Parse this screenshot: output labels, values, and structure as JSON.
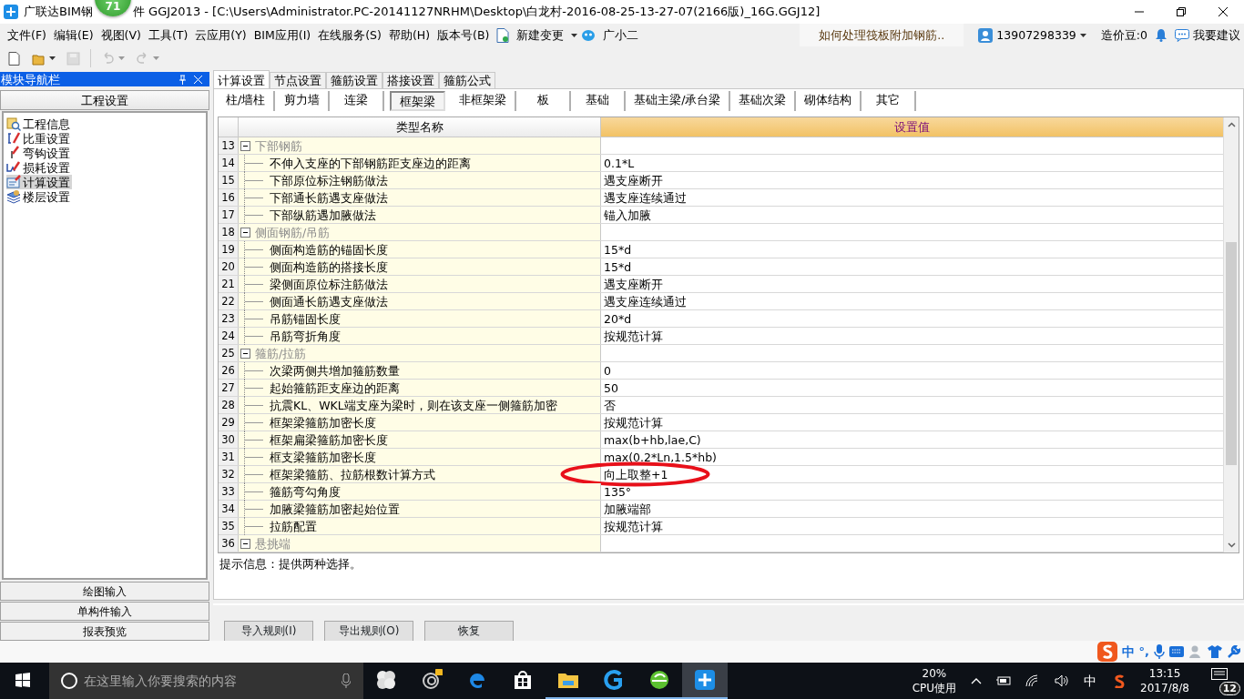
{
  "window": {
    "title_start": "广联达BIM钢",
    "badge": "71",
    "title_end": "件 GGJ2013 - [C:\\Users\\Administrator.PC-20141127NRHM\\Desktop\\白龙村-2016-08-25-13-27-07(2166版)_16G.GGJ12]"
  },
  "menu": [
    "文件(F)",
    "编辑(E)",
    "视图(V)",
    "工具(T)",
    "云应用(Y)",
    "BIM应用(I)",
    "在线服务(S)",
    "帮助(H)",
    "版本号(B)"
  ],
  "menu_extras": [
    {
      "kind": "new-change",
      "label": "新建变更"
    },
    {
      "kind": "assistant",
      "label": "广小二"
    }
  ],
  "news": "如何处理筏板附加钢筋..",
  "account": {
    "phone": "13907298339",
    "beans": "造价豆:0",
    "suggest": "我要建议"
  },
  "toolbar": [
    {
      "kind": "new",
      "disabled": false,
      "dropdown": false
    },
    {
      "kind": "open",
      "disabled": false,
      "dropdown": true
    },
    {
      "kind": "save",
      "disabled": true,
      "dropdown": false
    },
    {
      "kind": "undo",
      "disabled": true,
      "dropdown": true
    },
    {
      "kind": "redo",
      "disabled": true,
      "dropdown": true
    }
  ],
  "nav": {
    "title": "模块导航栏",
    "section": "工程设置",
    "items": [
      {
        "kind": "info",
        "label": "工程信息",
        "selected": false
      },
      {
        "kind": "density",
        "label": "比重设置",
        "selected": false
      },
      {
        "kind": "hook",
        "label": "弯钩设置",
        "selected": false
      },
      {
        "kind": "loss",
        "label": "损耗设置",
        "selected": false
      },
      {
        "kind": "calc",
        "label": "计算设置",
        "selected": true
      },
      {
        "kind": "floor",
        "label": "楼层设置",
        "selected": false
      }
    ],
    "bottom": [
      "绘图输入",
      "单构件输入",
      "报表预览"
    ]
  },
  "tabs": [
    {
      "label": "计算设置",
      "selected": true
    },
    {
      "label": "节点设置",
      "selected": false
    },
    {
      "label": "箍筋设置",
      "selected": false
    },
    {
      "label": "搭接设置",
      "selected": false
    },
    {
      "label": "箍筋公式",
      "selected": false
    }
  ],
  "subtabs": [
    {
      "label": "柱/墙柱",
      "selected": false
    },
    {
      "label": "剪力墙",
      "selected": false
    },
    {
      "label": "连梁",
      "selected": false
    },
    {
      "label": "框架梁",
      "selected": true
    },
    {
      "label": "非框架梁",
      "selected": false
    },
    {
      "label": "板",
      "selected": false
    },
    {
      "label": "基础",
      "selected": false
    },
    {
      "label": "基础主梁/承台梁",
      "selected": false
    },
    {
      "label": "基础次梁",
      "selected": false
    },
    {
      "label": "砌体结构",
      "selected": false
    },
    {
      "label": "其它",
      "selected": false
    }
  ],
  "grid": {
    "columns": [
      "类型名称",
      "设置值"
    ],
    "rows": [
      {
        "num": "13",
        "kind": "group",
        "name": "下部钢筋",
        "expanded": true
      },
      {
        "num": "14",
        "kind": "item",
        "name": "不伸入支座的下部钢筋距支座边的距离",
        "value": "0.1*L",
        "circled": false
      },
      {
        "num": "15",
        "kind": "item",
        "name": "下部原位标注钢筋做法",
        "value": "遇支座断开",
        "circled": false
      },
      {
        "num": "16",
        "kind": "item",
        "name": "下部通长筋遇支座做法",
        "value": "遇支座连续通过",
        "circled": false
      },
      {
        "num": "17",
        "kind": "item",
        "name": "下部纵筋遇加腋做法",
        "value": "锚入加腋",
        "circled": false
      },
      {
        "num": "18",
        "kind": "group",
        "name": "侧面钢筋/吊筋",
        "expanded": true
      },
      {
        "num": "19",
        "kind": "item",
        "name": "侧面构造筋的锚固长度",
        "value": "15*d",
        "circled": false
      },
      {
        "num": "20",
        "kind": "item",
        "name": "侧面构造筋的搭接长度",
        "value": "15*d",
        "circled": false
      },
      {
        "num": "21",
        "kind": "item",
        "name": "梁侧面原位标注筋做法",
        "value": "遇支座断开",
        "circled": false
      },
      {
        "num": "22",
        "kind": "item",
        "name": "侧面通长筋遇支座做法",
        "value": "遇支座连续通过",
        "circled": false
      },
      {
        "num": "23",
        "kind": "item",
        "name": "吊筋锚固长度",
        "value": "20*d",
        "circled": false
      },
      {
        "num": "24",
        "kind": "item",
        "name": "吊筋弯折角度",
        "value": "按规范计算",
        "circled": false
      },
      {
        "num": "25",
        "kind": "group",
        "name": "箍筋/拉筋",
        "expanded": true
      },
      {
        "num": "26",
        "kind": "item",
        "name": "次梁两侧共增加箍筋数量",
        "value": "0",
        "circled": false
      },
      {
        "num": "27",
        "kind": "item",
        "name": "起始箍筋距支座边的距离",
        "value": "50",
        "circled": false
      },
      {
        "num": "28",
        "kind": "item",
        "name": "抗震KL、WKL端支座为梁时，则在该支座一侧箍筋加密",
        "value": "否",
        "circled": false
      },
      {
        "num": "29",
        "kind": "item",
        "name": "框架梁箍筋加密长度",
        "value": "按规范计算",
        "circled": false
      },
      {
        "num": "30",
        "kind": "item",
        "name": "框架扁梁箍筋加密长度",
        "value": "max(b+hb,lae,C)",
        "circled": false
      },
      {
        "num": "31",
        "kind": "item",
        "name": "框支梁箍筋加密长度",
        "value": "max(0.2*Ln,1.5*hb)",
        "circled": false
      },
      {
        "num": "32",
        "kind": "item",
        "name": "框架梁箍筋、拉筋根数计算方式",
        "value": "向上取整+1",
        "circled": true
      },
      {
        "num": "33",
        "kind": "item",
        "name": "箍筋弯勾角度",
        "value": "135°",
        "circled": false
      },
      {
        "num": "34",
        "kind": "item",
        "name": "加腋梁箍筋加密起始位置",
        "value": "加腋端部",
        "circled": false
      },
      {
        "num": "35",
        "kind": "item",
        "name": "拉筋配置",
        "value": "按规范计算",
        "circled": false
      },
      {
        "num": "36",
        "kind": "group",
        "name": "悬挑端",
        "expanded": true
      }
    ]
  },
  "hint": "提示信息：提供两种选择。",
  "buttons": [
    "导入规则(I)",
    "导出规则(O)",
    "恢复"
  ],
  "ime": {
    "mode": "中",
    "punct": "°,"
  },
  "taskbar": {
    "search_placeholder": "在这里输入你要搜索的内容",
    "apps": [
      {
        "kind": "pinwheel",
        "running": false,
        "active": false
      },
      {
        "kind": "swirl",
        "running": false,
        "active": false
      },
      {
        "kind": "edge",
        "running": false,
        "active": false
      },
      {
        "kind": "store",
        "running": false,
        "active": false
      },
      {
        "kind": "folder",
        "running": true,
        "active": false
      },
      {
        "kind": "g-app",
        "running": true,
        "active": false
      },
      {
        "kind": "browser",
        "running": true,
        "active": false
      },
      {
        "kind": "ggj",
        "running": true,
        "active": true
      }
    ],
    "cpu_percent": "20%",
    "cpu_label": "CPU使用",
    "ime": "中",
    "time": "13:15",
    "date": "2017/8/8",
    "notifications": "12"
  }
}
